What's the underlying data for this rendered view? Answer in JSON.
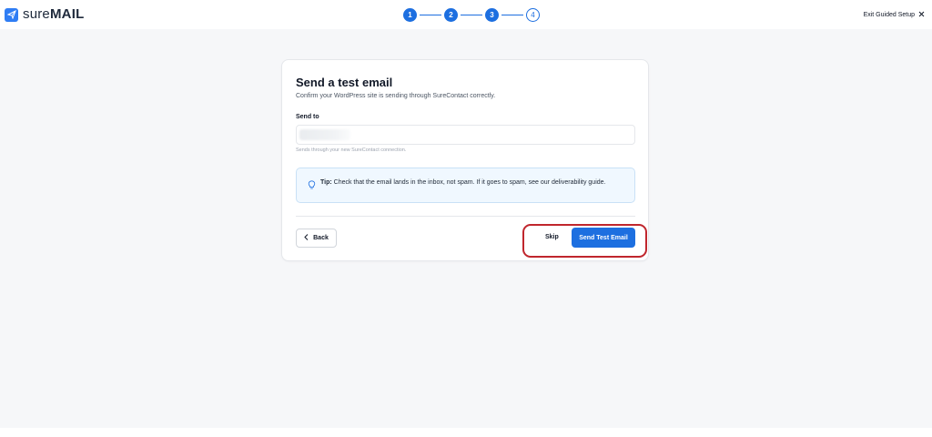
{
  "brand": {
    "name_part1": "sure",
    "name_part2": "MAIL",
    "accent": "#2f7df4"
  },
  "stepper": {
    "steps": [
      "1",
      "2",
      "3",
      "4"
    ],
    "current": 4,
    "accent": "#1d6fe0"
  },
  "header": {
    "exit_label": "Exit Guided Setup"
  },
  "card": {
    "title": "Send a test email",
    "subtitle": "Confirm your WordPress site is sending through SureContact correctly.",
    "field_label": "Send to",
    "email_value": "",
    "helper": "Sends through your new SureContact connection.",
    "tip_label": "Tip:",
    "tip_text": " Check that the email lands in the inbox, not spam. If it goes to spam, see our deliverability guide.",
    "back_label": "Back",
    "skip_label": "Skip",
    "send_label": "Send Test Email"
  },
  "colors": {
    "primary": "#1d6fe0",
    "highlight": "#c0262d",
    "tip_bg": "#f0f8ff"
  }
}
